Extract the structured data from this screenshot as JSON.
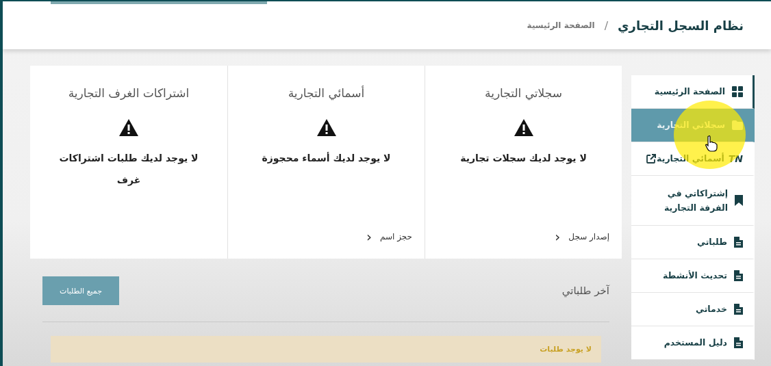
{
  "header": {
    "title": "نظام السجل التجاري",
    "separator": "/",
    "breadcrumb": "الصفحة الرئيسية"
  },
  "sidebar": {
    "items": [
      {
        "label": "الصفحة الرئيسية",
        "kind": "grid",
        "current": true,
        "selected": false
      },
      {
        "label": "سجلاتي التجارية",
        "kind": "folder",
        "current": false,
        "selected": true
      },
      {
        "label": "أسمائي التجارية",
        "kind": "text",
        "icon_text": "TN",
        "external": true,
        "current": false,
        "selected": false
      },
      {
        "label": "إشتراكاتي في الفرفة التجارية",
        "kind": "bookmark",
        "current": false,
        "selected": false
      },
      {
        "label": "طلباتي",
        "kind": "document",
        "current": false,
        "selected": false
      },
      {
        "label": "تحديث الأنشطة",
        "kind": "document",
        "current": false,
        "selected": false
      },
      {
        "label": "خدماتي",
        "kind": "document",
        "current": false,
        "selected": false
      },
      {
        "label": "دليل المستخدم",
        "kind": "document",
        "current": false,
        "selected": false
      }
    ]
  },
  "cards": [
    {
      "title": "سجلاتي التجارية",
      "message": "لا يوجد لديك سجلات تجارية",
      "link": "إصدار سجل",
      "link_arrow": "‹"
    },
    {
      "title": "أسمائي التجارية",
      "message": "لا يوجد لديك أسماء محجوزة",
      "link": "حجز اسم",
      "link_arrow": "‹"
    },
    {
      "title": "اشتراكات الغرف التجارية",
      "message": "لا يوجد لديك طلبات اشتراكات غرف"
    }
  ],
  "recent_requests": {
    "title": "آخر طلباتي",
    "button": "جميع الطلبات",
    "alert": "لا يوجد طلبات"
  }
}
